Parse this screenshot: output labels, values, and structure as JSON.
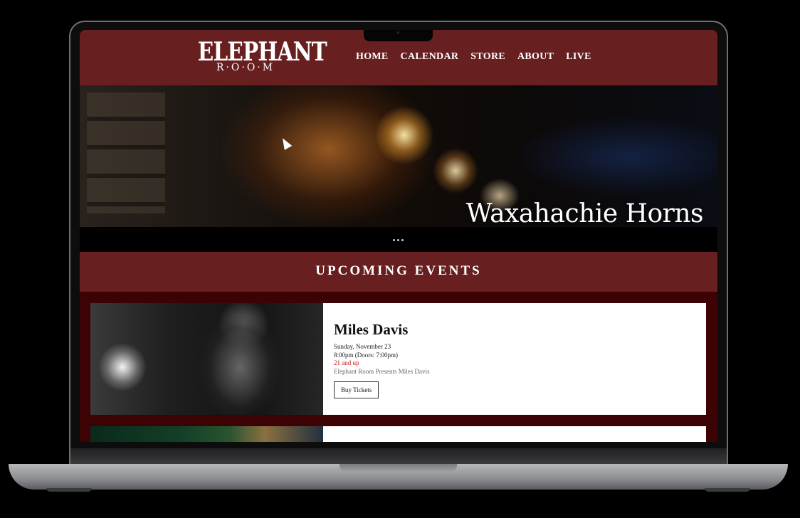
{
  "site": {
    "logo_main": "ELEPHANT",
    "logo_sub": "R·O·O·M"
  },
  "nav": {
    "items": [
      {
        "label": "HOME"
      },
      {
        "label": "CALENDAR"
      },
      {
        "label": "STORE"
      },
      {
        "label": "ABOUT"
      },
      {
        "label": "LIVE"
      }
    ]
  },
  "hero": {
    "title": "Waxahachie Horns",
    "slide_count": 3
  },
  "upcoming": {
    "title": "UPCOMING EVENTS"
  },
  "events": [
    {
      "name": "Miles Davis",
      "date": "Sunday, November 23",
      "time": "8:00pm (Doors: 7:00pm)",
      "age": "21 and up",
      "presenter": "Elephant Room Presents Miles Davis",
      "button_label": "Buy Tickets"
    }
  ],
  "colors": {
    "header": "#681f20",
    "events_bg": "#3d0304",
    "age_text": "#cc1111"
  }
}
